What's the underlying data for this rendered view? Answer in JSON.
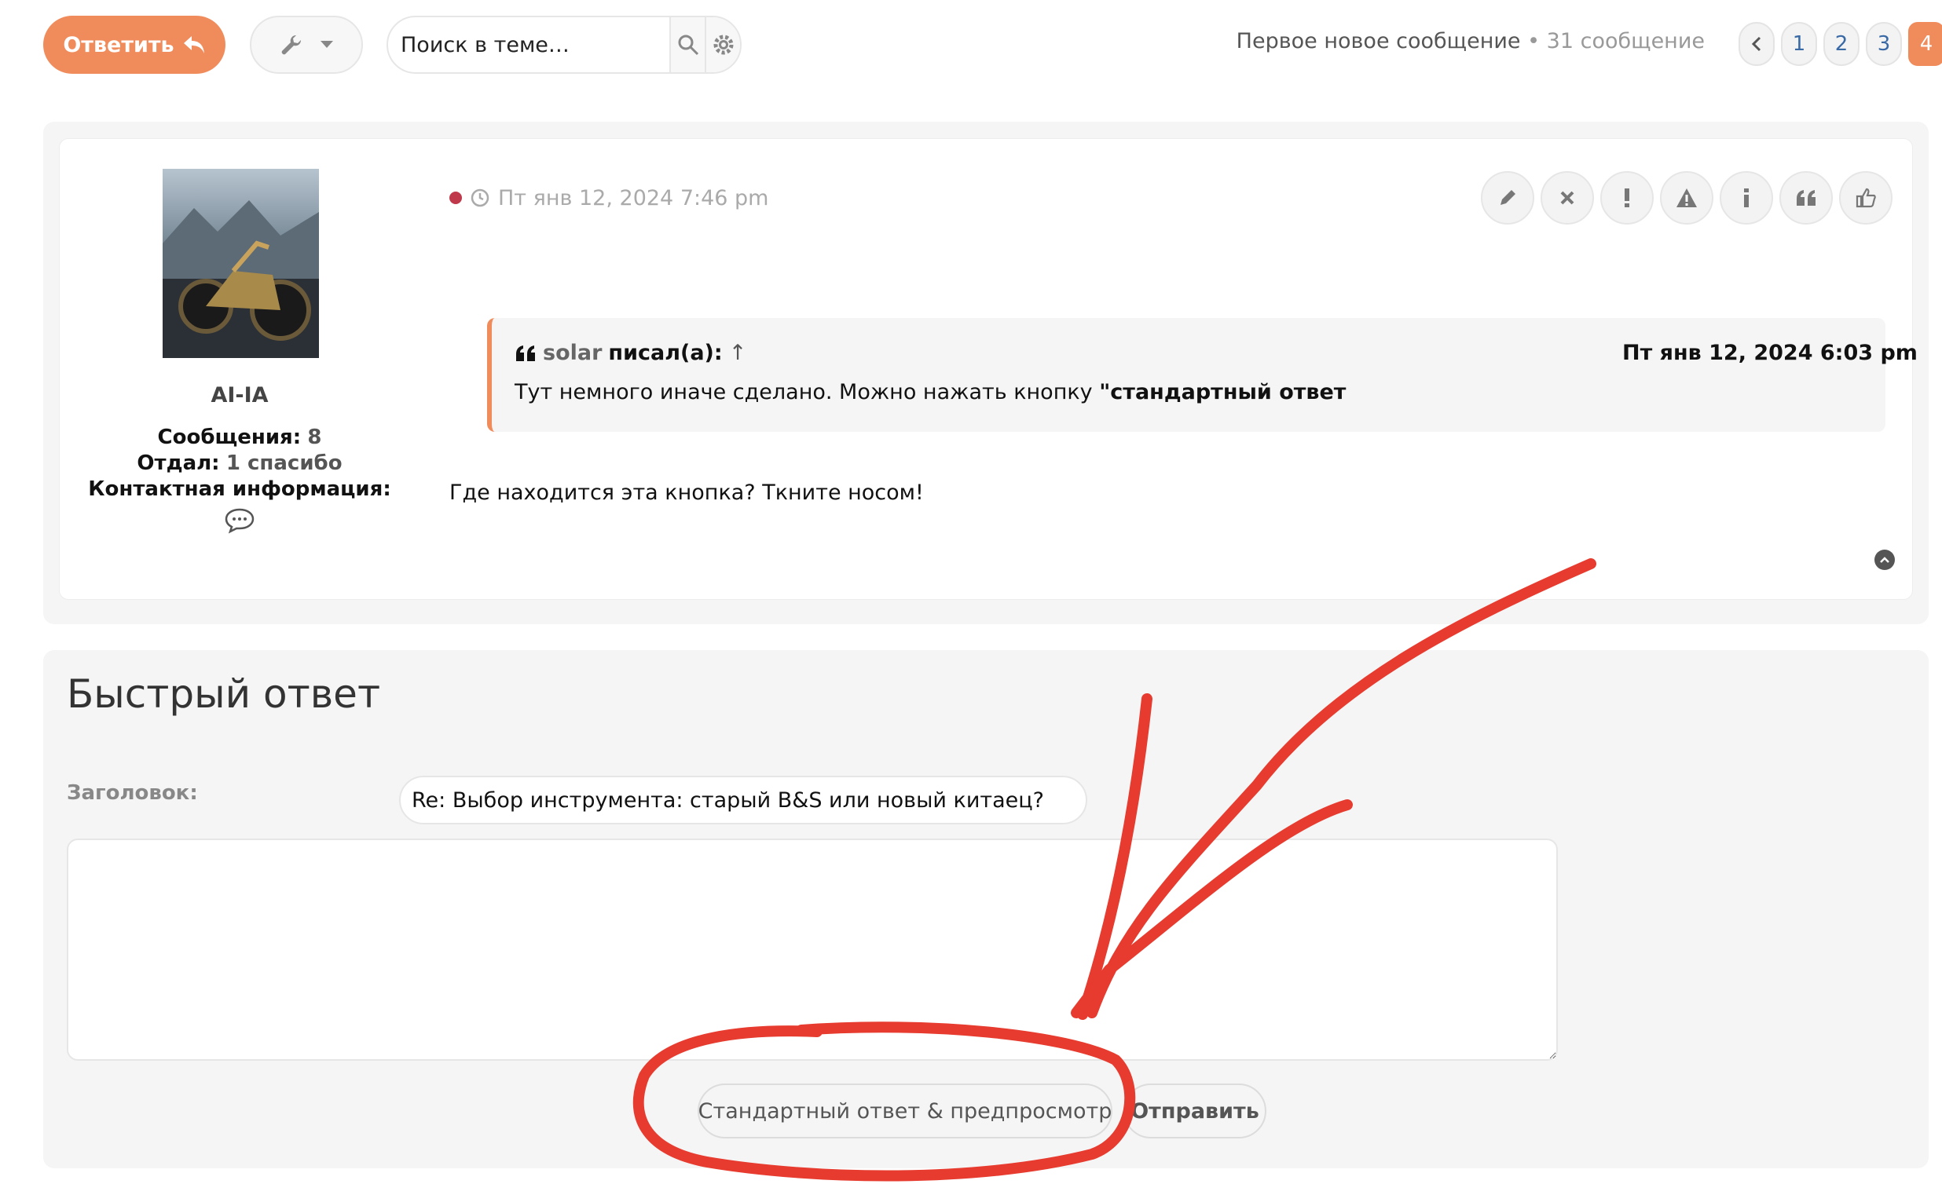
{
  "toolbar": {
    "reply_label": "Ответить",
    "search_placeholder": "Поиск в теме…"
  },
  "topic_info": {
    "first_unread": "Первое новое сообщение",
    "separator": "•",
    "post_count": "31 сообщение"
  },
  "pagination": {
    "pages": [
      "1",
      "2",
      "3",
      "4"
    ],
    "current": "4"
  },
  "post": {
    "datetime": "Пт янв 12, 2024 7:46 pm",
    "author": "AI-IA",
    "stats": {
      "posts_label": "Сообщения:",
      "posts_value": "8",
      "thanks_label": "Отдал:",
      "thanks_value": "1 спасибо",
      "contact_label": "Контактная информация:"
    },
    "quote": {
      "author": "solar",
      "wrote": "писал(а):",
      "arrow": "↑",
      "date": "Пт янв 12, 2024 6:03 pm",
      "text": "Тут немного иначе сделано. Можно нажать кнопку ",
      "text_bold": "\"стандартный ответ"
    },
    "body": "Где находится эта кнопка? Ткните носом!"
  },
  "quick_reply": {
    "title": "Быстрый ответ",
    "subject_label": "Заголовок:",
    "subject_value": "Re: Выбор инструмента: старый B&S или новый китаец?",
    "message_value": "",
    "preview_button": "Стандартный ответ & предпросмотр",
    "submit_button": "Отправить"
  },
  "colors": {
    "accent": "#f08c5c",
    "annotation": "#e63b2e",
    "online_dot": "#c0394b"
  }
}
